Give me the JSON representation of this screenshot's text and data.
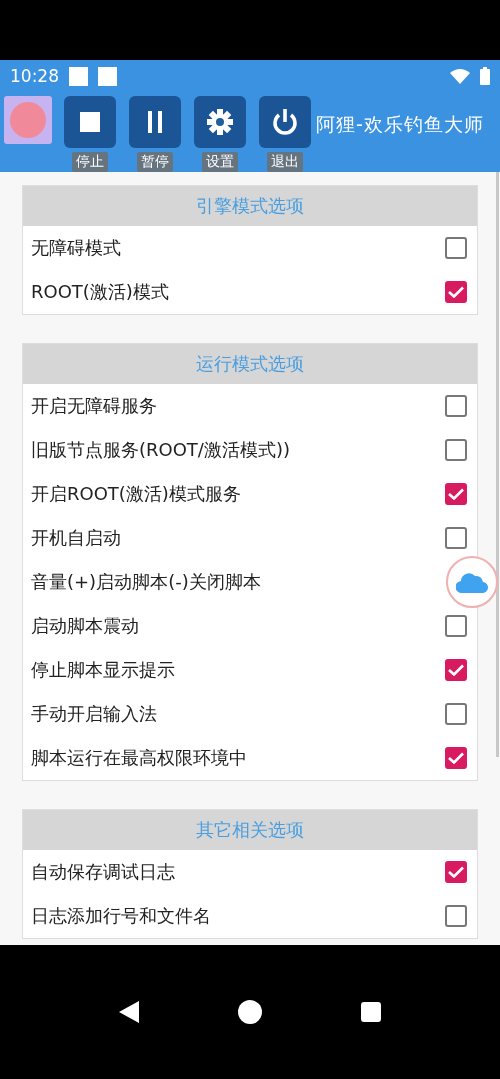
{
  "status_bar": {
    "time": "10:28"
  },
  "app_bar": {
    "title": "阿狸-欢乐钓鱼大师",
    "buttons": [
      {
        "kind": "stop",
        "label": "停止"
      },
      {
        "kind": "pause",
        "label": "暂停"
      },
      {
        "kind": "settings",
        "label": "设置"
      },
      {
        "kind": "exit",
        "label": "退出"
      }
    ]
  },
  "sections": [
    {
      "title": "引擎模式选项",
      "options": [
        {
          "label": "无障碍模式",
          "checked": false
        },
        {
          "label": "ROOT(激活)模式",
          "checked": true
        }
      ]
    },
    {
      "title": "运行模式选项",
      "options": [
        {
          "label": "开启无障碍服务",
          "checked": false
        },
        {
          "label": "旧版节点服务(ROOT/激活模式))",
          "checked": false
        },
        {
          "label": "开启ROOT(激活)模式服务",
          "checked": true
        },
        {
          "label": "开机自启动",
          "checked": false
        },
        {
          "label": "音量(+)启动脚本(-)关闭脚本"
        },
        {
          "label": "启动脚本震动",
          "checked": false
        },
        {
          "label": "停止脚本显示提示",
          "checked": true
        },
        {
          "label": "手动开启输入法",
          "checked": false
        },
        {
          "label": "脚本运行在最高权限环境中",
          "checked": true
        }
      ]
    },
    {
      "title": "其它相关选项",
      "options": [
        {
          "label": "自动保存调试日志",
          "checked": true
        },
        {
          "label": "日志添加行号和文件名",
          "checked": false
        }
      ]
    }
  ]
}
